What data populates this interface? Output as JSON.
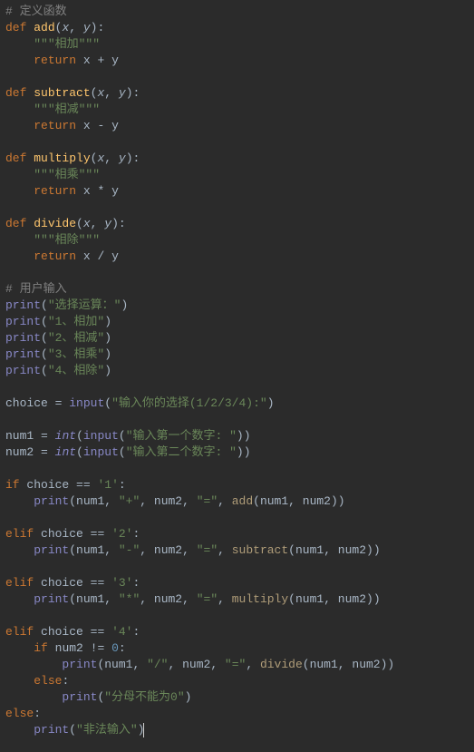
{
  "comments": {
    "define_fn": "# 定义函数",
    "user_input": "# 用户输入"
  },
  "functions": {
    "add": {
      "name": "add",
      "p1": "x",
      "p2": "y",
      "doc": "\"\"\"相加\"\"\"",
      "ret_a": "x",
      "ret_b": "y",
      "op": "+"
    },
    "subtract": {
      "name": "subtract",
      "p1": "x",
      "p2": "y",
      "doc": "\"\"\"相减\"\"\"",
      "ret_a": "x",
      "ret_b": "y",
      "op": "-"
    },
    "multiply": {
      "name": "multiply",
      "p1": "x",
      "p2": "y",
      "doc": "\"\"\"相乘\"\"\"",
      "ret_a": "x",
      "ret_b": "y",
      "op": "*"
    },
    "divide": {
      "name": "divide",
      "p1": "x",
      "p2": "y",
      "doc": "\"\"\"相除\"\"\"",
      "ret_a": "x",
      "ret_b": "y",
      "op": "/"
    }
  },
  "prints": {
    "menu_title": "\"选择运算：\"",
    "menu_1": "\"1、相加\"",
    "menu_2": "\"2、相减\"",
    "menu_3": "\"3、相乘\"",
    "menu_4": "\"4、相除\"",
    "choice_prompt": "\"输入你的选择(1/2/3/4):\"",
    "num1_prompt": "\"输入第一个数字: \"",
    "num2_prompt": "\"输入第二个数字: \"",
    "denom_zero": "\"分母不能为0\"",
    "illegal": "\"非法输入\""
  },
  "vars": {
    "choice": "choice",
    "num1": "num1",
    "num2": "num2"
  },
  "kw": {
    "def": "def",
    "return": "return",
    "if": "if",
    "elif": "elif",
    "else": "else"
  },
  "builtins": {
    "print": "print",
    "input": "input",
    "int": "int"
  },
  "calls": {
    "add": "add",
    "subtract": "subtract",
    "multiply": "multiply",
    "divide": "divide"
  },
  "literals": {
    "eq": "=",
    "dq1": "'1'",
    "dq2": "'2'",
    "dq3": "'3'",
    "dq4": "'4'",
    "zero": "0",
    "plus": "\"+\"",
    "minus": "\"-\"",
    "star": "\"*\"",
    "slash": "\"/\"",
    "eqs": "\"=\""
  }
}
